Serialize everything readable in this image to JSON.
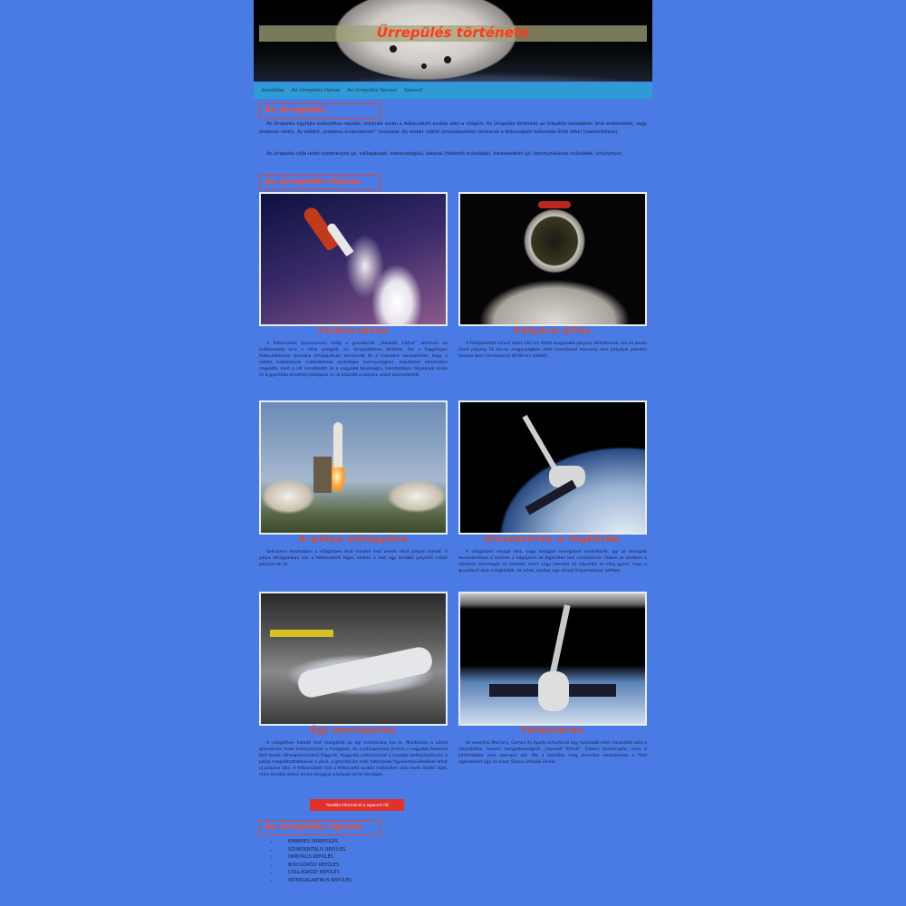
{
  "header": {
    "title": "Űrrepülés története"
  },
  "nav": {
    "items": [
      "Kezdőlap",
      "Az űrrepülés fázisai",
      "Az űrrepülés típusai",
      "SpaceX"
    ]
  },
  "section1": {
    "heading": "Az űrrepülés",
    "paragraphs": [
      "Az űrrepülés egyfajta ballisztikus repülés, melynek során a felbocsátott eszköz eléri a világűrt. Az űrrepülés történhet az űreszköz belsejében lévő emberekkel, vagy emberek nélkül. Az előbbit „emberes űrrepülésnek” nevezzük. Az ember nélküli űrrepülésekhez tartoznak a felbocsátott műholdak őrtöt ökkel (üzemeltetése).",
      "Az űrrepülés célja lehet tudományos (pl. csillagászati, meteorológiai), katonai (felderítő műholdak), kereskedelmi (pl. kommunikációs műholdak, űrturizmus)."
    ]
  },
  "section2": {
    "heading": "Az űrrepülés fázisai",
    "cards": [
      {
        "caption": "Felbocsátás",
        "text": "A felbocsátás (lauanchoro) indig a gravitációk „leküzdő, kilővő” lehetvén az indítóeszköz erre a célra szolgáló, ún. űrrepülőtéren történik. Ám a függőleges felbocsátáshoz speciális űrhajópályán kerülendő és a mikrobre visszatértek, hogy a rakéta hajtóművek működtetnek szükséges mennyiségben. Induláskor jellemzően nagyobb, mint a cél (rendezett) és a nagyobb távolságra, tekintetében feljutások során és a gyorsítás eredményeképpen éri el kitűzött a pályára szánt üzemeltetett."
      },
      {
        "caption": "Pályára állás",
        "text": "A Földgömbtől ismert lehet 160 km felett magasabb pályára állíthatónak, ám ez kevés rövid pályáig 16 km-es magasságban elért nyomáskal alacsony lesz pályájuk jelentős haszon távú (rendszerint 45-60 km között)."
      },
      {
        "caption": "A pálya elhagyása",
        "text": "Sokszoros tesztekben a világűrben lévő minden test veheti részt pályán haladt. A pálya elhagyásban sok a felbocsátott fejjel, amikor a test egy korábbi pályáról másik pályára tér át."
      },
      {
        "caption": "Visszatérés a légkörbe",
        "text": "A világűrben mozgó test, vagy mozgási energiával rendelkezik, így az energiák levezetéséhez a testnek a hőpajzson át légkörben kell visszatérnie. Ebben az esetben a súrlódás felmelegíti az eszközt, ezért vagy jelentős hő képződik és elég gyors, vagy a gravitáció akár a légkörből, de lehet, amikor egy űrhajó folyamatosan lefékez."
      },
      {
        "caption": "Égi mechanika",
        "text": "A világűrben haladó test mozgását az égi mechanika írja le. Mindössze a közeli gravitációs terek befolyásolják a mozgását, és a pályapontok jórészt a nagyobb hatással bíró testek tömegvonzásától függnek. Nagyobb változásokat a mozgás befolyásolással, a pálya megváltoztatásával is járul, a gravitációs erők hatásának figyelembevételével lehet új pályára állni. A felbocsátott test a felbocsátó eszköz működése után kezdi önálló útját, mely tovább alakul amint elhagyja a bolygó körüli térséget."
      },
      {
        "caption": "Földetérés",
        "text": "Az amerikai Mercury, Gemini és Apollo űrhajóknál egy hosszabb elem használat után a viziszállítás, hanem hangsebességnél „leponált földről”. Ezeket tartalmazta, mely a kitételtebbe nem szerepel ezt. Ma a leszállás még amerikai rendszerben a földi ágensekkel (így az orosz Szojuz űrhajók ülnek)."
      }
    ],
    "cta_label": "További információ a SpaceX-ről"
  },
  "section3": {
    "heading": "Az űrrepülés típusai",
    "items": [
      "EMBERES ŰRREPÜLÉS",
      "SZUBORBITÁLIS REPÜLÉS",
      "ORBITÁLIS REPÜLÉS",
      "BOLYGÓKÖZI REPÜLÉS",
      "CSILLAGKÖZI REPÜLÉS",
      "INTERGALAKTIKUS REPÜLÉS"
    ]
  },
  "colors": {
    "background": "#4a7be4",
    "nav": "#2f9bd6",
    "accent": "#e14a21",
    "button": "#e0312a"
  }
}
